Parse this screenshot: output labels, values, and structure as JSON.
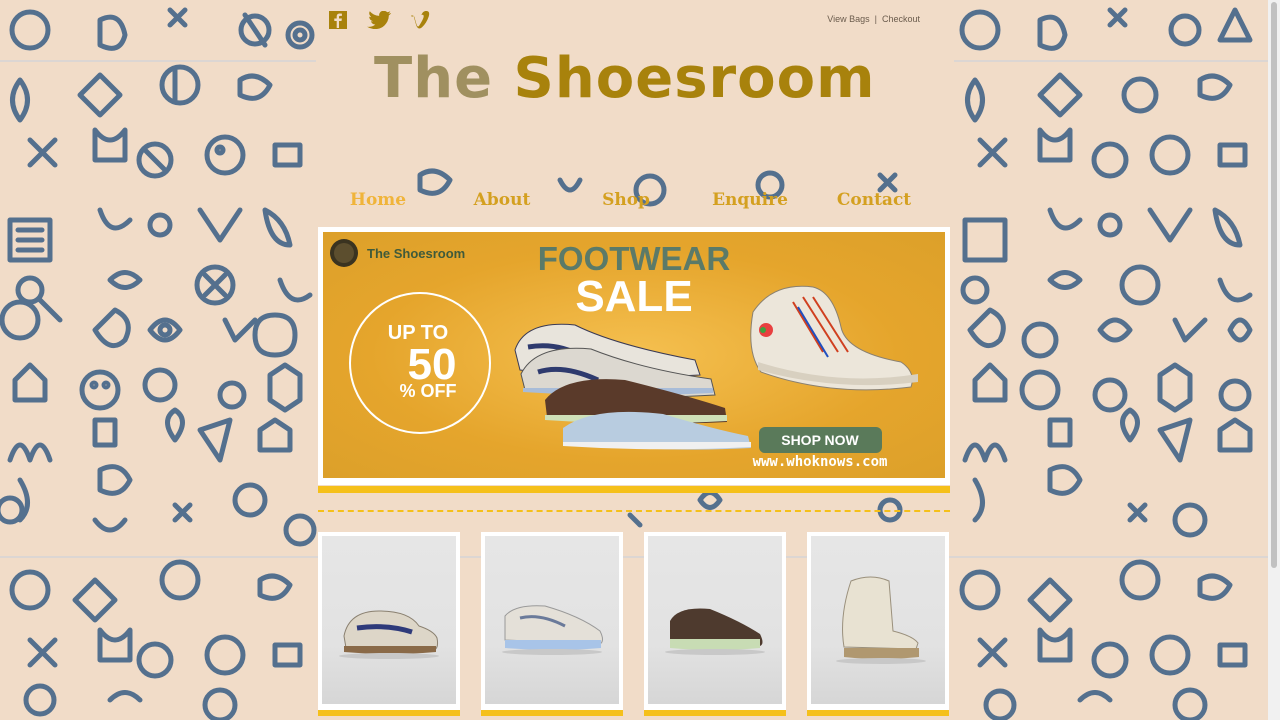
{
  "header": {
    "top_links": [
      "View Bags",
      "Checkout"
    ],
    "separator": "|",
    "logo_word1": "The",
    "logo_word2": "Shoesroom",
    "social_icons": [
      "facebook-icon",
      "twitter-icon",
      "vimeo-icon"
    ]
  },
  "nav": {
    "items": [
      "Home",
      "About",
      "Shop",
      "Enquire",
      "Contact"
    ],
    "active": "Home"
  },
  "banner": {
    "brand": "The Shoesroom",
    "headline1": "FOOTWEAR",
    "headline2": "SALE",
    "discount_top": "UP TO",
    "discount_number": "50",
    "discount_bottom": "% OFF",
    "cta": "SHOP NOW",
    "url": "www.whoknows.com"
  },
  "products": [
    {
      "name": "beige-sneaker-navy-stripe"
    },
    {
      "name": "white-sneaker-blue-sole"
    },
    {
      "name": "brown-sneaker-green-sole"
    },
    {
      "name": "cream-high-top-sneaker"
    }
  ],
  "colors": {
    "background": "#f1dcc8",
    "accent": "#f5c01a",
    "nav": "#d4a020",
    "logo_dark": "#a8820c",
    "logo_light": "#a09060",
    "cta_bg": "#5a7a5a"
  }
}
